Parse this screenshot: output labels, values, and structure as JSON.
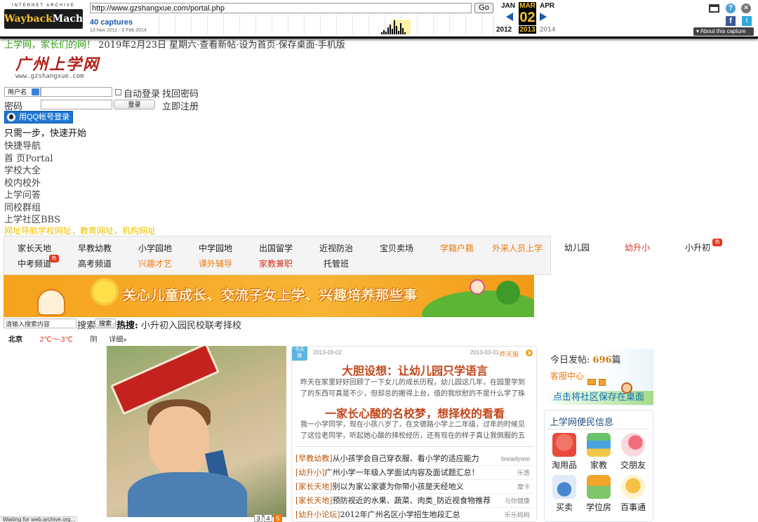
{
  "wayback": {
    "logo_top": "INTERNET ARCHIVE",
    "logo_main_a": "Wayback",
    "logo_main_b": "Machine",
    "url": "http://www.gzshangxue.com/portal.php",
    "go_label": "Go",
    "captures": "40 captures",
    "range": "13 Nov 2011 - 6 Feb 2014",
    "months": [
      "JAN",
      "MAR",
      "APR"
    ],
    "day": "02",
    "years": [
      "2012",
      "2013",
      "2014"
    ],
    "about_label": "About this capture",
    "icons": [
      "window-icon",
      "help-icon",
      "close-icon",
      "facebook-icon",
      "twitter-icon"
    ],
    "accent_color": "#f5c22b"
  },
  "header": {
    "site_slogan": "上学网，家长们的网！",
    "date_links": "2019年2月23日 星期六·查看新帖·设为首页·保存桌面·手机版",
    "logo_text": "广州上学网",
    "logo_url_text": "www.gzshangxue.com"
  },
  "login": {
    "type_select": "用户名",
    "auto_login": "自动登录",
    "forgot": "找回密码",
    "password_label": "密码",
    "login_button": "登录",
    "register": "立即注册",
    "qq_button": "用QQ帐号登录",
    "quick_tip": "只需一步，快速开始"
  },
  "sidenav": {
    "items": [
      "快捷导航",
      "首 页Portal",
      "学校大全",
      "校内校外",
      "上学问答",
      "同校群组",
      "上学社区BBS"
    ],
    "yellow_links": "网址导航学校网址，教育网址，机构网址"
  },
  "catnav": {
    "row1": [
      {
        "label": "家长天地",
        "style": "normal"
      },
      {
        "label": "早教幼教",
        "style": "normal"
      },
      {
        "label": "小学园地",
        "style": "normal"
      },
      {
        "label": "中学园地",
        "style": "normal"
      },
      {
        "label": "出国留学",
        "style": "normal"
      },
      {
        "label": "近视防治",
        "style": "normal"
      },
      {
        "label": "宝贝卖场",
        "style": "normal"
      },
      {
        "label": "学籍户籍",
        "style": "orange"
      },
      {
        "label": "外来人员上学",
        "style": "orange"
      }
    ],
    "row2": [
      {
        "label": "中考频道",
        "style": "normal",
        "hot": true
      },
      {
        "label": "高考频道",
        "style": "normal"
      },
      {
        "label": "兴趣才艺",
        "style": "orange"
      },
      {
        "label": "课外辅导",
        "style": "orange"
      },
      {
        "label": "家教兼职",
        "style": "red"
      },
      {
        "label": "托管班",
        "style": "normal"
      }
    ],
    "extra": [
      {
        "label": "幼儿园",
        "style": "normal"
      },
      {
        "label": "幼升小",
        "style": "red"
      },
      {
        "label": "小升初",
        "style": "normal",
        "hot": true
      }
    ],
    "hot_label": "热"
  },
  "banner": {
    "slogan": "关心儿童成长、交流子女上学、兴趣培养那些事"
  },
  "search": {
    "placeholder": "请输入搜索内容",
    "label": "搜索",
    "button": "搜索",
    "hot_label": "热搜:",
    "hot_terms": "小升初入园民校联考择校"
  },
  "weather": {
    "city": "北京",
    "temp": "2℃～-3℃",
    "cond": "阴",
    "more": "详细»"
  },
  "photo_pager": [
    "3",
    "4",
    "5"
  ],
  "news": {
    "tab": "今天 推",
    "date_left": "2013-03-02",
    "date_right": "2013-03-01",
    "yesterday": "昨天版",
    "headline1": "大胆设想：让幼儿园只学语言",
    "summary1": "昨天在家里好好回顾了一下女儿的成长历程，幼儿园这几年，在园里学到了的东西可真是不少，但却总的搬得上台，值的我欣慰的不是什么学了珠心算，学",
    "headline2": "一家长心酸的名校梦，想择校的看看",
    "summary2": "我一小学同学，现在小孩八岁了，在文德路小学上二年级，过年的时候见了这位老同学，听起她心酸的择校经历，还有现在的样子真让我佩服的五体投",
    "items": [
      {
        "cat": "[早教幼教]",
        "title": "从小孩学会自己穿衣服、看小学的适应能力",
        "author": "breadywei"
      },
      {
        "cat": "[幼升小]",
        "title": "广州小学一年级入学面试内容及面试题汇总！",
        "author": "乐悠"
      },
      {
        "cat": "[家长天地]",
        "title": "别以为家公家婆为你带小孩是天经地义",
        "author": "摩卡"
      },
      {
        "cat": "[家长天地]",
        "title": "预防视近的水果、蔬菜、肉类_防近视食物推荐",
        "author": "与你健康"
      },
      {
        "cat": "[幼升小论坛]",
        "title": "2012年广州名区小学招生地段汇总",
        "author": "乐乐妈妈"
      }
    ]
  },
  "right": {
    "today_label": "今日发帖:",
    "today_count": "696",
    "today_unit": "篇",
    "service": "客服中心",
    "save_desktop": "点击将社区保存在桌面",
    "conv_title": "上学网便民信息",
    "conv_items": [
      {
        "label": "淘用品",
        "icon": "shopping-bag-icon",
        "color": "#e8493b"
      },
      {
        "label": "家教",
        "icon": "books-icon",
        "color": "#4aa3df"
      },
      {
        "label": "交朋友",
        "icon": "heart-chat-icon",
        "color": "#f06d7b"
      },
      {
        "label": "买卖",
        "icon": "cart-icon",
        "color": "#4a86d0"
      },
      {
        "label": "学位房",
        "icon": "house-icon",
        "color": "#f2a42b"
      },
      {
        "label": "百事通",
        "icon": "service-person-icon",
        "color": "#f5c246"
      }
    ]
  },
  "status": "Waiting for web.archive.org..."
}
